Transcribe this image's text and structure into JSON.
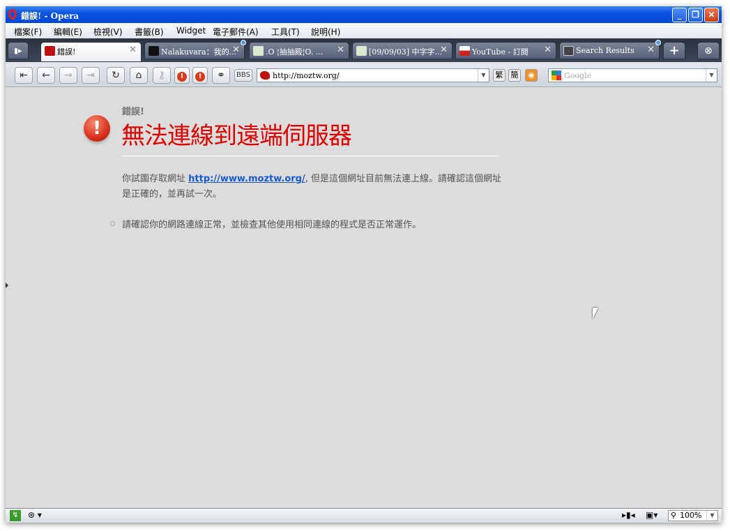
{
  "window": {
    "title": "錯誤! - Opera"
  },
  "menu": [
    "檔案(F)",
    "編輯(E)",
    "檢視(V)",
    "書籤(B)",
    "Widget",
    "電子郵件(A)",
    "工具(T)",
    "說明(H)"
  ],
  "tabs": [
    {
      "label": "錯誤!",
      "active": true
    },
    {
      "label": "Nalakuvara：我的...",
      "active": false
    },
    {
      "label": ".O ¦抽抽殿¦O. ...",
      "active": false
    },
    {
      "label": "[09/09/03] 中字字...",
      "active": false
    },
    {
      "label": "YouTube - 訂閱",
      "active": false
    },
    {
      "label": "Search Results",
      "active": false
    }
  ],
  "toolbar": {
    "bbs": "BBS",
    "address": "http://moztw.org/",
    "trad": "繁",
    "simp": "簡",
    "search_placeholder": "Google"
  },
  "page": {
    "subtitle": "錯誤!",
    "heading": "無法連線到遠端伺服器",
    "p_before": "你試圖存取網址 ",
    "link": "http://www.moztw.org/",
    "p_after": ", 但是這個網址目前無法連上線。請確認這個網址是正確的，並再試一次。",
    "bullet": "請確認你的網路連線正常，並檢查其他使用相同連線的程式是否正常運作。"
  },
  "status": {
    "zoom": "100%"
  }
}
